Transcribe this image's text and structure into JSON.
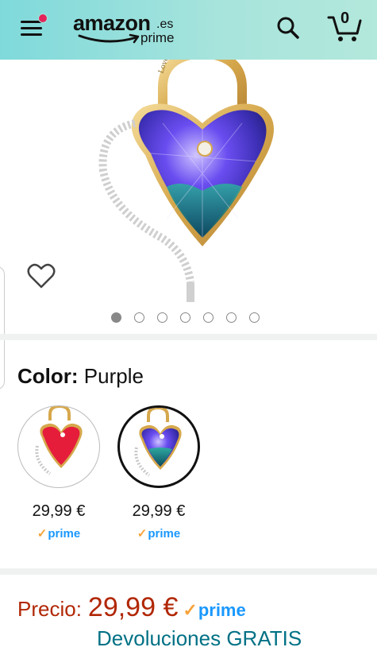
{
  "header": {
    "logo_text": "amazon",
    "logo_domain": ".es",
    "logo_prime": "prime",
    "cart_count": "0",
    "background": "#a8e4dc",
    "notification_color": "#e3245a"
  },
  "gallery": {
    "image_icon": "heart-pendant-purple",
    "engraving": "Love Is A Padlock",
    "slide_count": 7,
    "active_slide": 1
  },
  "variation": {
    "label": "Color:",
    "selected_value": "Purple",
    "options": [
      {
        "icon": "heart-pendant-red",
        "price": "29,99 €",
        "prime": "prime",
        "selected": false
      },
      {
        "icon": "heart-pendant-purple",
        "price": "29,99 €",
        "prime": "prime",
        "selected": true
      }
    ]
  },
  "price": {
    "label": "Precio:",
    "value": "29,99 €",
    "prime": "prime",
    "color": "#b12704"
  },
  "delivery": {
    "text": "Devoluciones GRATIS"
  },
  "colors": {
    "prime_blue": "#1a98ff",
    "prime_check": "#f7a33b",
    "link": "#007185"
  }
}
